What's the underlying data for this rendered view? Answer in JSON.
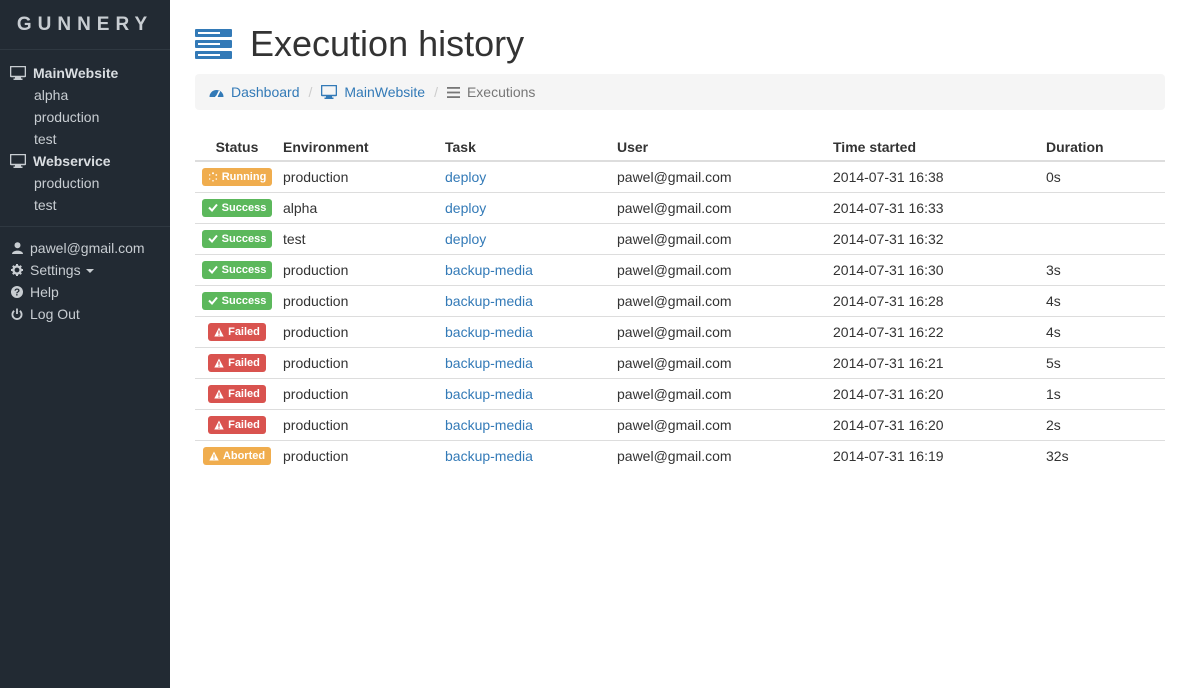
{
  "brand": "GUNNERY",
  "sidebar": {
    "projects": [
      {
        "name": "MainWebsite",
        "environments": [
          "alpha",
          "production",
          "test"
        ]
      },
      {
        "name": "Webservice",
        "environments": [
          "production",
          "test"
        ]
      }
    ],
    "user_menu": {
      "email": "pawel@gmail.com",
      "settings": "Settings",
      "help": "Help",
      "logout": "Log Out"
    }
  },
  "page": {
    "title": "Execution history"
  },
  "breadcrumb": {
    "dashboard": "Dashboard",
    "project": "MainWebsite",
    "current": "Executions",
    "separator": "/"
  },
  "table": {
    "headers": {
      "status": "Status",
      "environment": "Environment",
      "task": "Task",
      "user": "User",
      "time_started": "Time started",
      "duration": "Duration"
    },
    "rows": [
      {
        "status": "Running",
        "environment": "production",
        "task": "deploy",
        "user": "pawel@gmail.com",
        "time_started": "2014-07-31 16:38",
        "duration": "0s"
      },
      {
        "status": "Success",
        "environment": "alpha",
        "task": "deploy",
        "user": "pawel@gmail.com",
        "time_started": "2014-07-31 16:33",
        "duration": ""
      },
      {
        "status": "Success",
        "environment": "test",
        "task": "deploy",
        "user": "pawel@gmail.com",
        "time_started": "2014-07-31 16:32",
        "duration": ""
      },
      {
        "status": "Success",
        "environment": "production",
        "task": "backup-media",
        "user": "pawel@gmail.com",
        "time_started": "2014-07-31 16:30",
        "duration": "3s"
      },
      {
        "status": "Success",
        "environment": "production",
        "task": "backup-media",
        "user": "pawel@gmail.com",
        "time_started": "2014-07-31 16:28",
        "duration": "4s"
      },
      {
        "status": "Failed",
        "environment": "production",
        "task": "backup-media",
        "user": "pawel@gmail.com",
        "time_started": "2014-07-31 16:22",
        "duration": "4s"
      },
      {
        "status": "Failed",
        "environment": "production",
        "task": "backup-media",
        "user": "pawel@gmail.com",
        "time_started": "2014-07-31 16:21",
        "duration": "5s"
      },
      {
        "status": "Failed",
        "environment": "production",
        "task": "backup-media",
        "user": "pawel@gmail.com",
        "time_started": "2014-07-31 16:20",
        "duration": "1s"
      },
      {
        "status": "Failed",
        "environment": "production",
        "task": "backup-media",
        "user": "pawel@gmail.com",
        "time_started": "2014-07-31 16:20",
        "duration": "2s"
      },
      {
        "status": "Aborted",
        "environment": "production",
        "task": "backup-media",
        "user": "pawel@gmail.com",
        "time_started": "2014-07-31 16:19",
        "duration": "32s"
      }
    ]
  },
  "colors": {
    "sidebar_bg": "#222a33",
    "link": "#337ab7",
    "running": "#f0ad4e",
    "success": "#5cb85c",
    "failed": "#d9534f",
    "aborted": "#f0ad4e"
  },
  "icons": {
    "project": "monitor-icon",
    "user": "user-icon",
    "settings": "gear-icon",
    "help": "question-circle-icon",
    "logout": "power-icon",
    "dashboard": "dashboard-icon",
    "executions": "list-icon",
    "page": "server-icon"
  }
}
